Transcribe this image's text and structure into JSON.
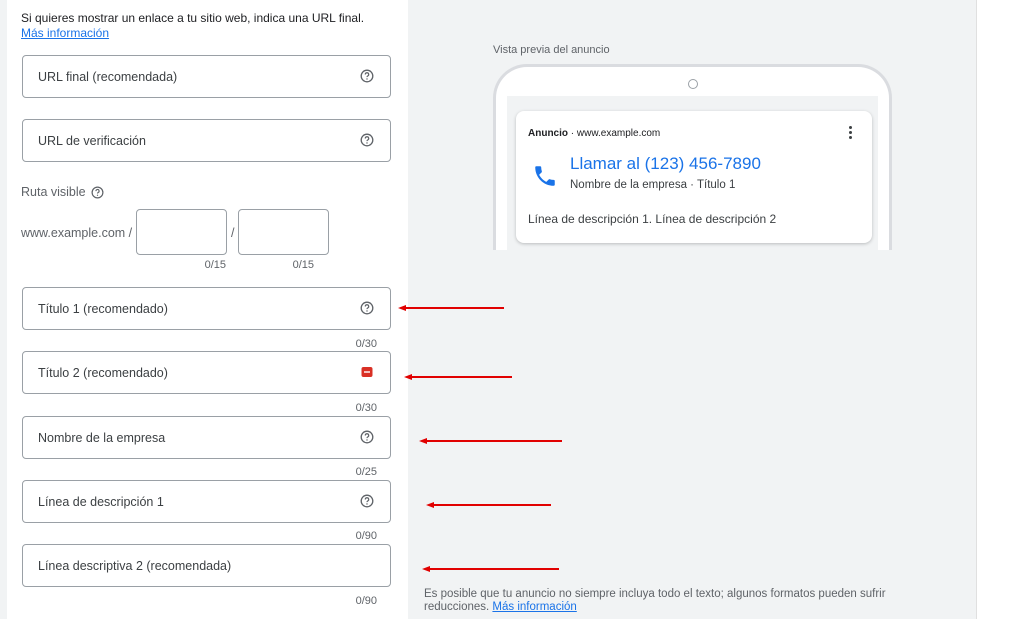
{
  "form": {
    "intro_text": "Si quieres mostrar un enlace a tu sitio web, indica una URL final.",
    "intro_link": "Más información",
    "final_url_label": "URL final (recomendada)",
    "tracking_url_label": "URL de verificación",
    "ruta_label": "Ruta visible",
    "domain": "www.example.com /",
    "slash": "/",
    "path1_counter": "0/15",
    "path2_counter": "0/15",
    "title1_label": "Título 1 (recomendado)",
    "title1_counter": "0/30",
    "title2_label": "Título 2 (recomendado)",
    "title2_counter": "0/30",
    "business_label": "Nombre de la empresa",
    "business_counter": "0/25",
    "desc1_label": "Línea de descripción 1",
    "desc1_counter": "0/90",
    "desc2_label": "Línea descriptiva 2 (recomendada)",
    "desc2_counter": "0/90"
  },
  "preview": {
    "title": "Vista previa del anuncio",
    "ad_badge": "Anuncio",
    "ad_sep": " · ",
    "ad_domain": "www.example.com",
    "headline": "Llamar al (123) 456-7890",
    "subline": "Nombre de la empresa · Título 1",
    "description": "Línea de descripción 1. Línea de descripción 2",
    "note": "Es posible que tu anuncio no siempre incluya todo el texto; algunos formatos pueden sufrir reducciones.",
    "note_link": "Más información"
  },
  "icons": {
    "help": "question-circle-icon",
    "error": "error-icon",
    "phone": "phone-icon",
    "menu": "more-vert-icon",
    "arrow": "red-arrow-icon"
  },
  "colors": {
    "link": "#1a73e8",
    "error": "#d93025",
    "arrow": "#e10000",
    "border": "#9aa0a6"
  }
}
